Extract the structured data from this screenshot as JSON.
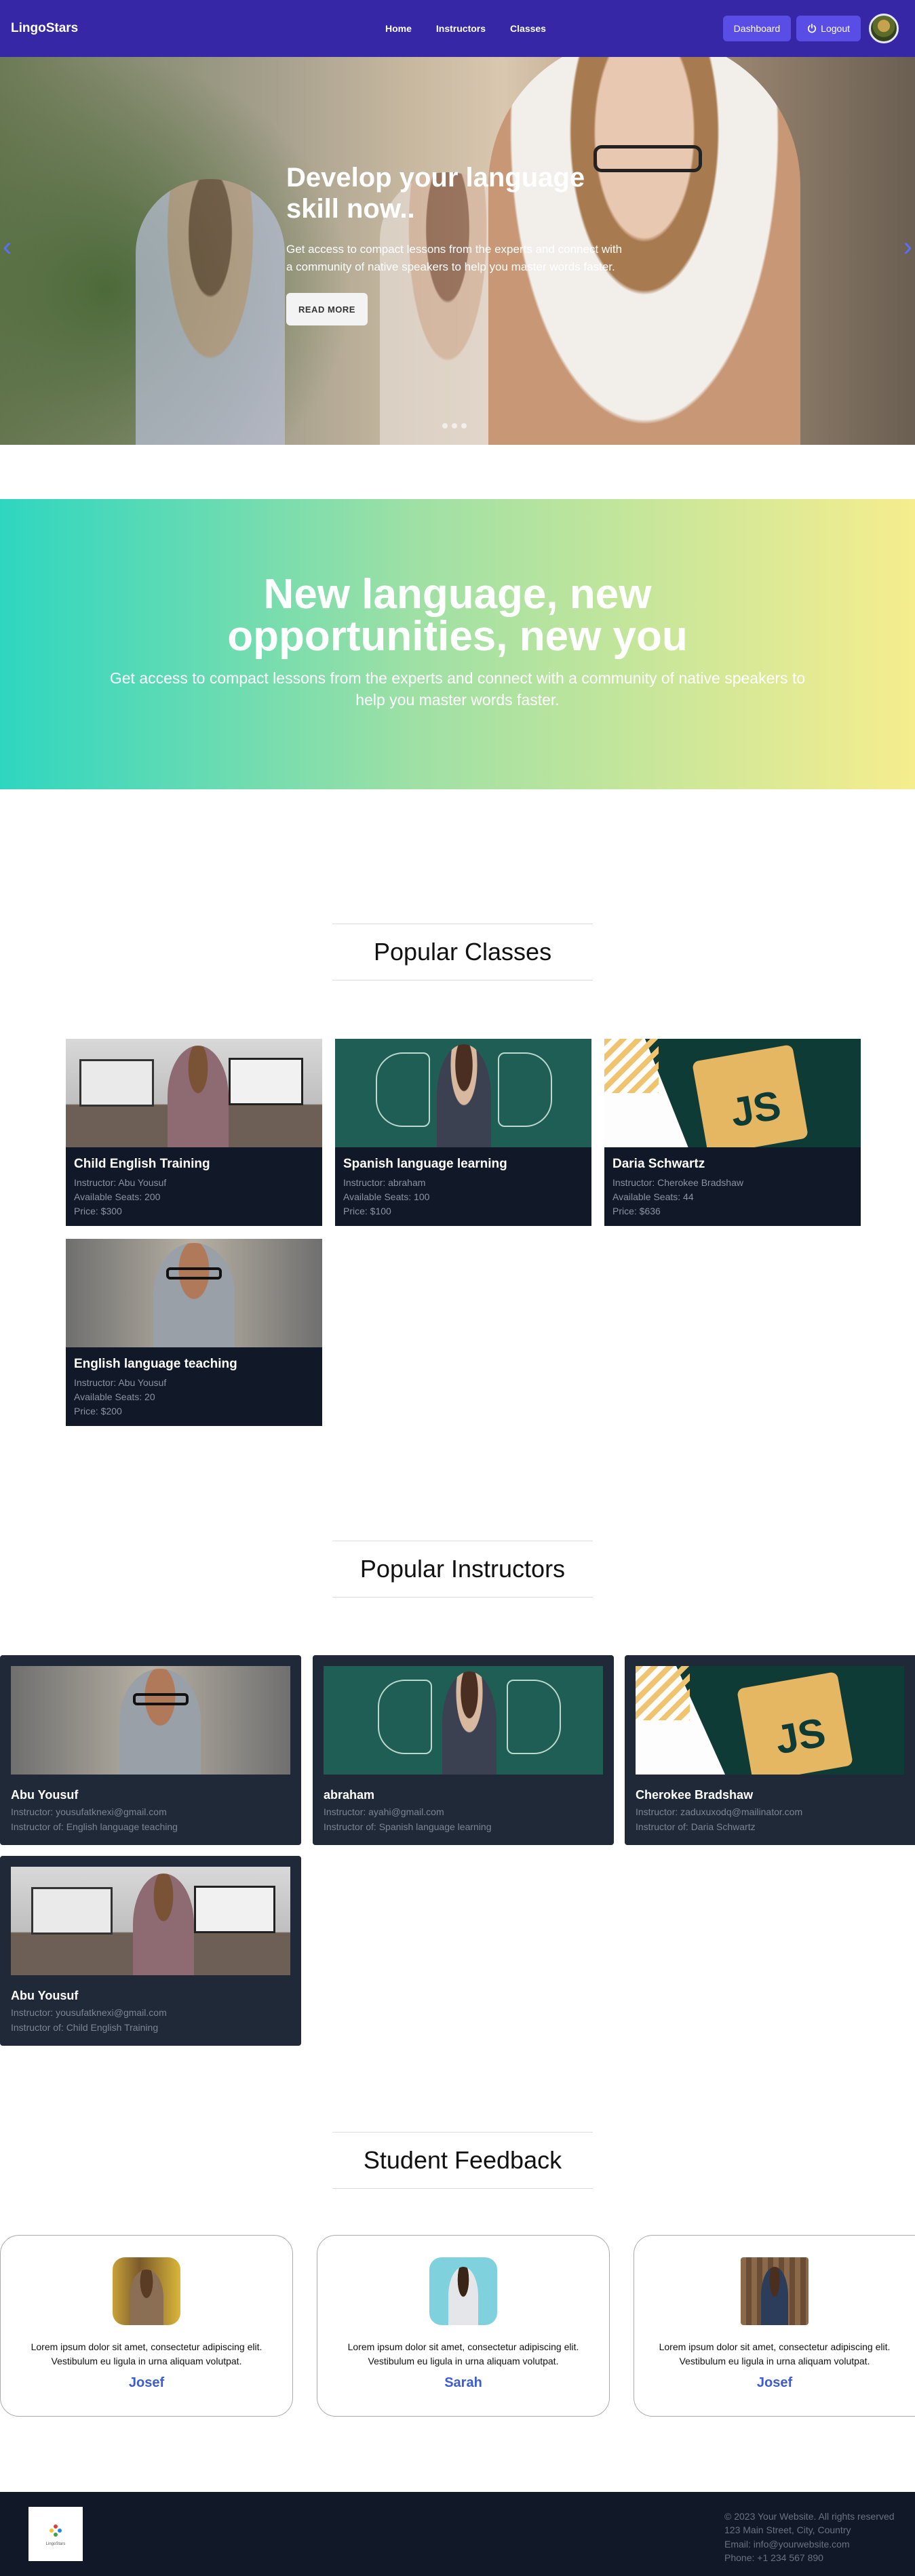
{
  "nav": {
    "brand": "LingoStars",
    "links": [
      "Home",
      "Instructors",
      "Classes"
    ],
    "dashboard_label": "Dashboard",
    "logout_label": "Logout"
  },
  "hero": {
    "title": "Develop your language skill now..",
    "description": "Get access to compact lessons from the experts and connect with a community of native speakers to help you master words faster.",
    "button_label": "READ MORE"
  },
  "banner": {
    "title": "New language, new opportunities, new you",
    "description": "Get access to compact lessons from the experts and connect with a community of native speakers to help you master words faster."
  },
  "popular_classes": {
    "title": "Popular Classes",
    "items": [
      {
        "name": "Child English Training",
        "instructor": "Instructor: Abu Yousuf",
        "seats": "Available Seats: 200",
        "price": "Price: $300"
      },
      {
        "name": "Spanish language learning",
        "instructor": "Instructor: abraham",
        "seats": "Available Seats: 100",
        "price": "Price: $100"
      },
      {
        "name": "Daria Schwartz",
        "instructor": "Instructor: Cherokee Bradshaw",
        "seats": "Available Seats: 44",
        "price": "Price: $636"
      },
      {
        "name": "English language teaching",
        "instructor": "Instructor: Abu Yousuf",
        "seats": "Available Seats: 20",
        "price": "Price: $200"
      }
    ]
  },
  "popular_instructors": {
    "title": "Popular Instructors",
    "items": [
      {
        "name": "Abu Yousuf",
        "email": "Instructor: yousufatknexi@gmail.com",
        "classes": "Instructor of: English language teaching"
      },
      {
        "name": "abraham",
        "email": "Instructor: ayahi@gmail.com",
        "classes": "Instructor of: Spanish language learning"
      },
      {
        "name": "Cherokee Bradshaw",
        "email": "Instructor: zaduxuxodq@mailinator.com",
        "classes": "Instructor of: Daria Schwartz"
      },
      {
        "name": "Abu Yousuf",
        "email": "Instructor: yousufatknexi@gmail.com",
        "classes": "Instructor of: Child English Training"
      }
    ]
  },
  "feedback": {
    "title": "Student Feedback",
    "items": [
      {
        "text": "Lorem ipsum dolor sit amet, consectetur adipiscing elit. Vestibulum eu ligula in urna aliquam volutpat.",
        "name": "Josef"
      },
      {
        "text": "Lorem ipsum dolor sit amet, consectetur adipiscing elit. Vestibulum eu ligula in urna aliquam volutpat.",
        "name": "Sarah"
      },
      {
        "text": "Lorem ipsum dolor sit amet, consectetur adipiscing elit. Vestibulum eu ligula in urna aliquam volutpat.",
        "name": "Josef"
      }
    ]
  },
  "footer": {
    "copyright": "© 2023 Your Website. All rights reserved",
    "address": "123 Main Street, City, Country",
    "email": "Email: info@yourwebsite.com",
    "phone": "Phone: +1 234 567 890",
    "logo_text": "LingoStars"
  },
  "colors": {
    "nav": "#3527a5",
    "button": "#5a4de6",
    "card_dark": "#111827",
    "instructor_card": "#1f2937",
    "feedback_name": "#3b5bd8"
  }
}
